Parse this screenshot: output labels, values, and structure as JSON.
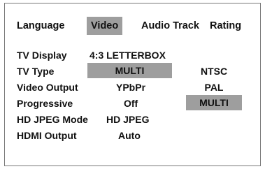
{
  "tabs": [
    {
      "label": "Language"
    },
    {
      "label": "Video",
      "selected": true
    },
    {
      "label": "Audio Track"
    },
    {
      "label": "Rating"
    }
  ],
  "settings": [
    {
      "label": "TV Display",
      "value": "4:3 LETTERBOX"
    },
    {
      "label": "TV Type",
      "value": "MULTI",
      "active": true
    },
    {
      "label": "Video Output",
      "value": "YPbPr"
    },
    {
      "label": "Progressive",
      "value": "Off"
    },
    {
      "label": "HD JPEG Mode",
      "value": "HD JPEG"
    },
    {
      "label": "HDMI Output",
      "value": "Auto"
    }
  ],
  "options": [
    {
      "label": "NTSC"
    },
    {
      "label": "PAL"
    },
    {
      "label": "MULTI",
      "selected": true
    }
  ],
  "colors": {
    "highlight": "#9e9e9e",
    "text": "#111111",
    "border": "#777777"
  }
}
